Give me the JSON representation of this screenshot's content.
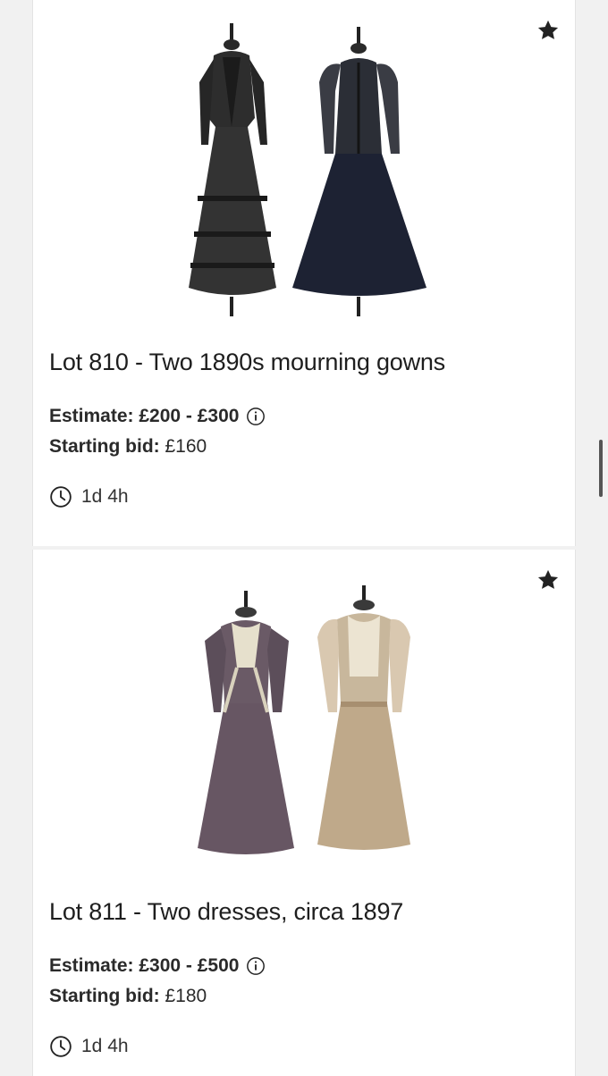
{
  "lots": [
    {
      "title": "Lot 810 - Two 1890s mourning gowns",
      "estimate": "Estimate: £200 - £300",
      "starting_bid_label": "Starting bid:",
      "starting_bid_value": "£160",
      "time_left": "1d 4h",
      "image_desc": "two black Victorian mourning gowns on dress forms"
    },
    {
      "title": "Lot 811 - Two dresses, circa 1897",
      "estimate": "Estimate: £300 - £500",
      "starting_bid_label": "Starting bid:",
      "starting_bid_value": "£180",
      "time_left": "1d 4h",
      "image_desc": "purple gown and beige gown with lace trim on dress forms"
    }
  ],
  "icons": {
    "favorite": "star-icon",
    "info": "info-icon",
    "time": "clock-icon"
  },
  "colors": {
    "background": "#f1f1f1",
    "card": "#ffffff",
    "text": "#1f1f1f",
    "icon": "#222222"
  }
}
